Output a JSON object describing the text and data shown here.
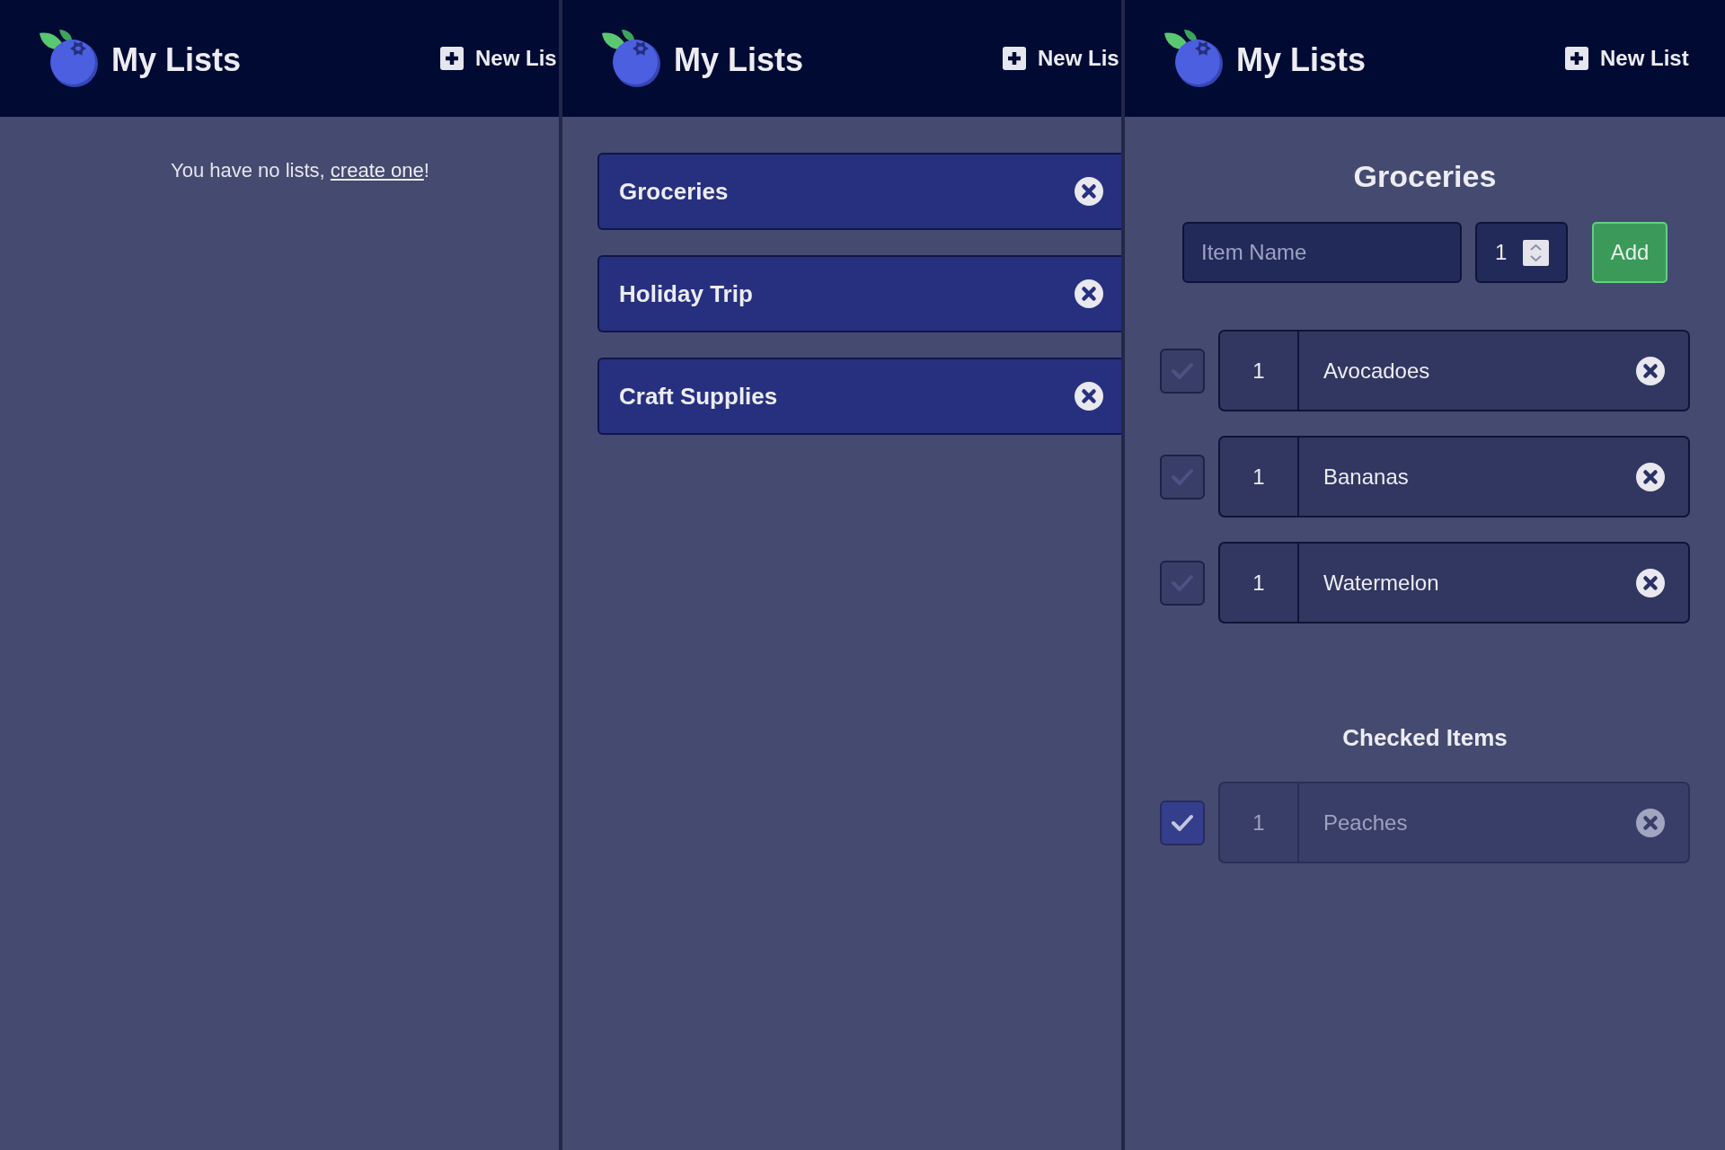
{
  "panels": [
    {
      "kind": "empty",
      "header": {
        "title": "My Lists",
        "new_list_button": "New Lis"
      },
      "message": {
        "before": "You have no lists, ",
        "link": "create one",
        "after": "!"
      }
    },
    {
      "kind": "lists",
      "header": {
        "title": "My Lists",
        "new_list_button": "New Lis"
      },
      "lists": [
        {
          "name": "Groceries"
        },
        {
          "name": "Holiday Trip"
        },
        {
          "name": "Craft Supplies"
        }
      ]
    },
    {
      "kind": "detail",
      "header": {
        "title": "My Lists",
        "new_list_button": "New List"
      },
      "title": "Groceries",
      "form": {
        "item_name": {
          "placeholder": "Item Name"
        },
        "quantity": {
          "value": "1"
        },
        "add_button": "Add"
      },
      "items": [
        {
          "quantity": "1",
          "name": "Avocadoes",
          "checked": false
        },
        {
          "quantity": "1",
          "name": "Bananas",
          "checked": false
        },
        {
          "quantity": "1",
          "name": "Watermelon",
          "checked": false
        }
      ],
      "checked_heading": "Checked Items",
      "checked_items": [
        {
          "quantity": "1",
          "name": "Peaches",
          "checked": true
        }
      ]
    }
  ]
}
